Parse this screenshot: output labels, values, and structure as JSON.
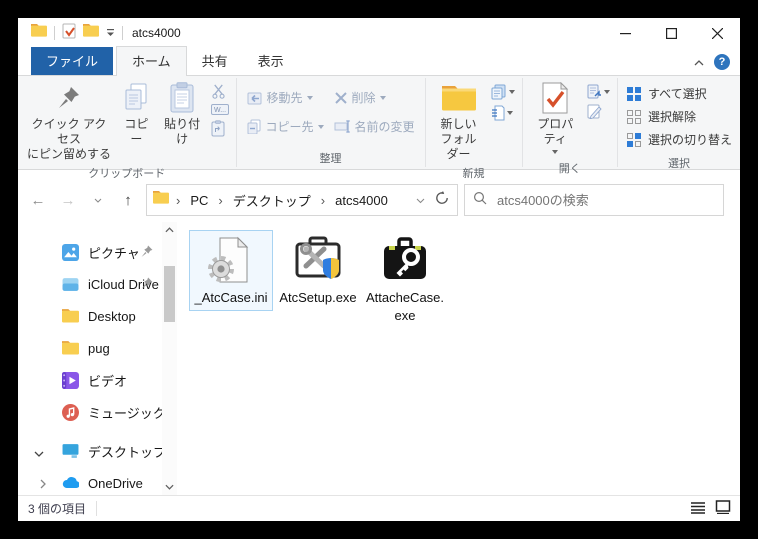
{
  "window": {
    "title": "atcs4000"
  },
  "tabs": {
    "file": "ファイル",
    "home": "ホーム",
    "share": "共有",
    "view": "表示"
  },
  "ribbon": {
    "pin_to_quick_access": {
      "line1": "クイック アクセス",
      "line2": "にピン留めする"
    },
    "copy": "コピー",
    "paste": "貼り付け",
    "path_copy_icon_text": "W...",
    "move_to": "移動先",
    "copy_to": "コピー先",
    "delete": "削除",
    "rename": "名前の変更",
    "new_folder": {
      "line1": "新しい",
      "line2": "フォルダー"
    },
    "properties": "プロパティ",
    "select_all": "すべて選択",
    "clear_selection": "選択解除",
    "invert_selection": "選択の切り替え",
    "groups": {
      "clipboard": "クリップボード",
      "organize": "整理",
      "new": "新規",
      "open": "開く",
      "select": "選択"
    }
  },
  "toolbar": {
    "breadcrumb": [
      "PC",
      "デスクトップ",
      "atcs4000"
    ],
    "search_placeholder": "atcs4000の検索"
  },
  "sidebar": {
    "items": [
      {
        "label": "ピクチャ",
        "pinned": true
      },
      {
        "label": "iCloud Drive",
        "pinned": true
      },
      {
        "label": "Desktop",
        "pinned": false
      },
      {
        "label": "pug",
        "pinned": false
      },
      {
        "label": "ビデオ",
        "pinned": false
      },
      {
        "label": "ミュージック",
        "pinned": false
      },
      {
        "label": "デスクトップ",
        "pinned": false
      },
      {
        "label": "OneDrive",
        "pinned": false
      }
    ]
  },
  "files": [
    {
      "name": "_AtcCase.ini",
      "selected": true
    },
    {
      "name": "AtcSetup.exe",
      "selected": false
    },
    {
      "name": "AttacheCase.exe",
      "selected": false
    }
  ],
  "statusbar": {
    "item_count": "3 個の項目"
  },
  "colors": {
    "accent_blue": "#2162a8",
    "selection_border": "#a8d3f2",
    "selection_fill": "#f1f8fe",
    "folder_yellow": "#f8ce50"
  }
}
